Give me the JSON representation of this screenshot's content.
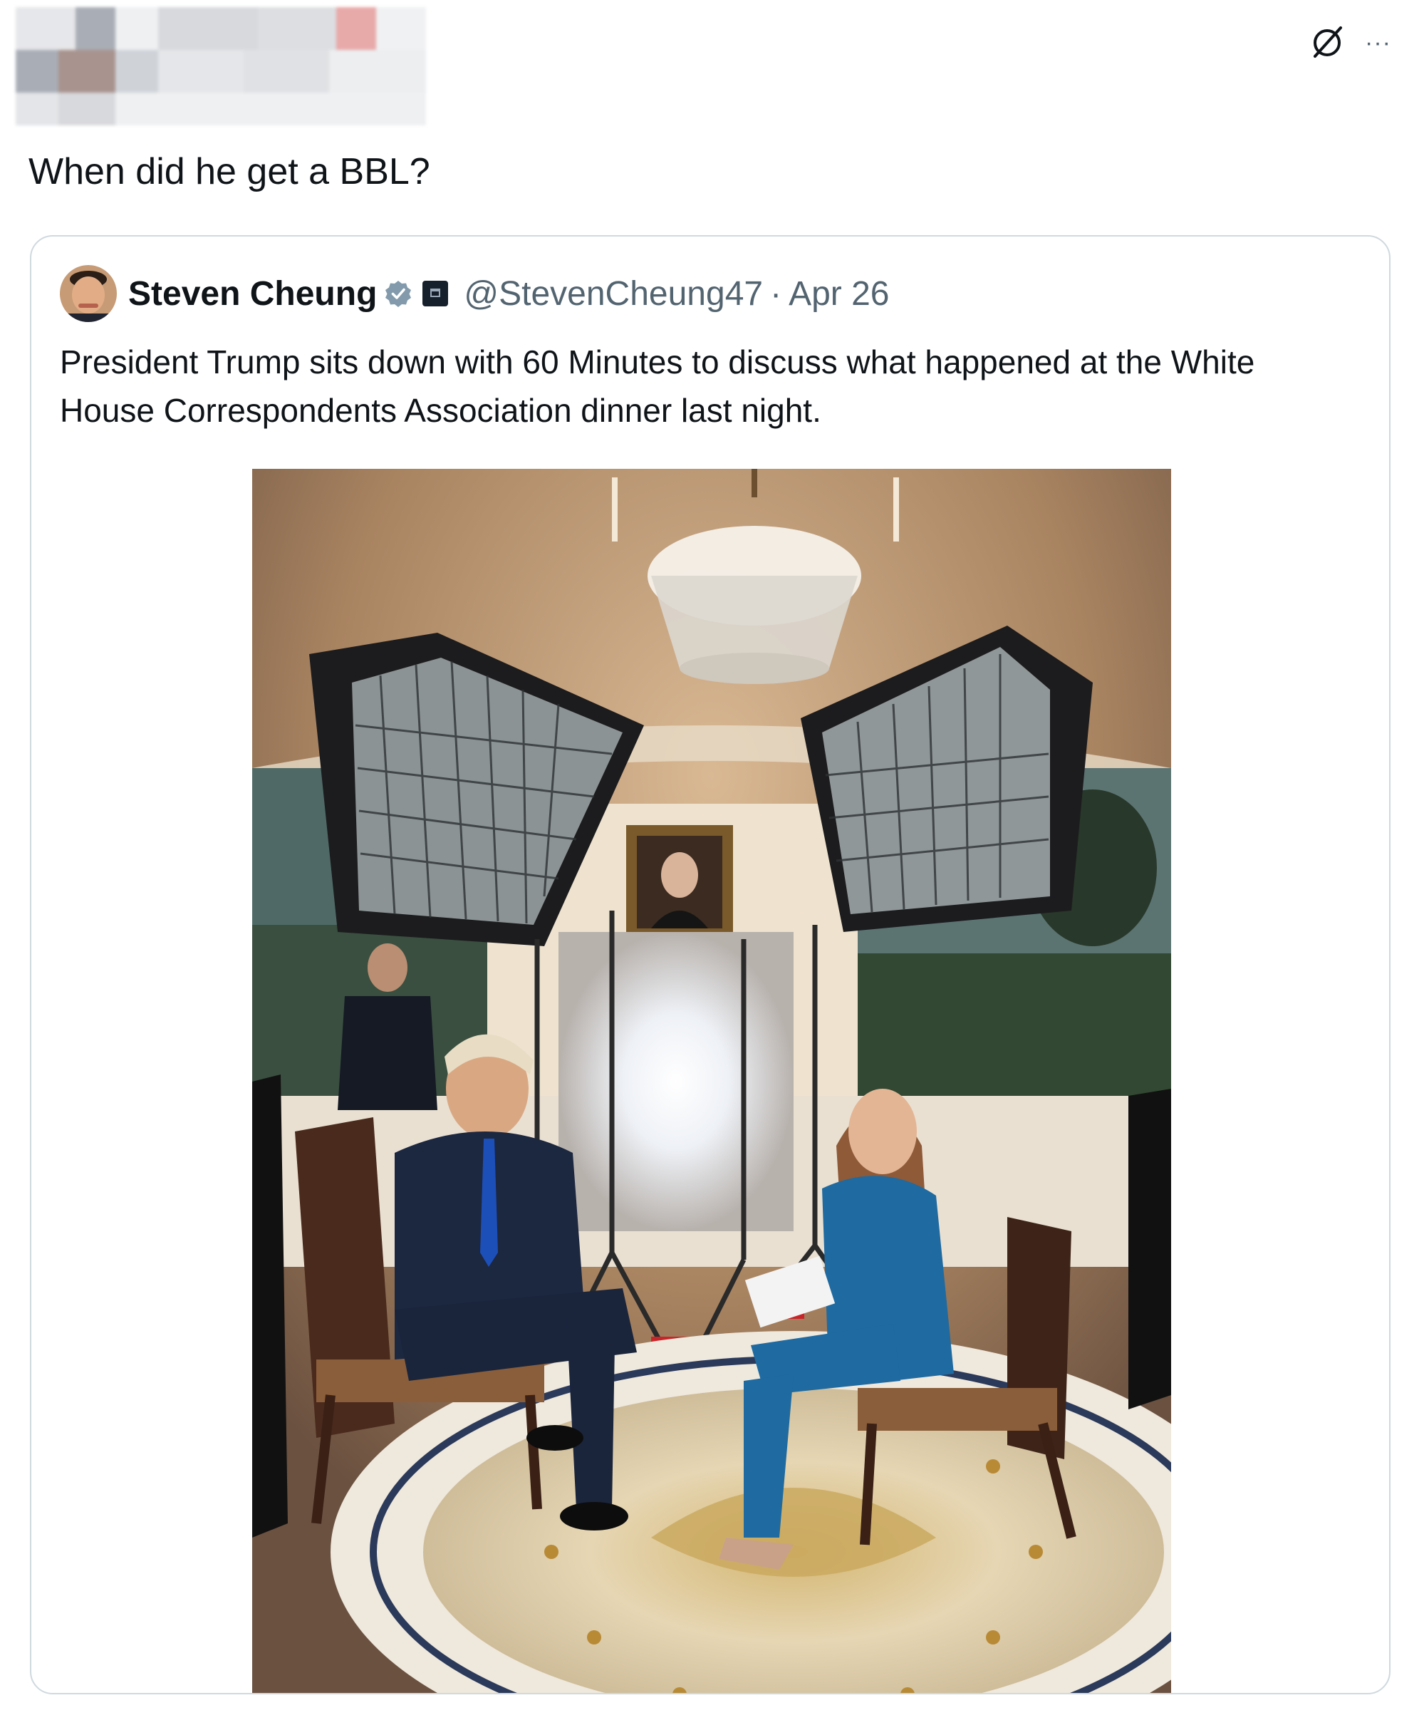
{
  "tweet": {
    "text": "When did he get a BBL?"
  },
  "header": {
    "grok_icon": "grok-icon",
    "more_icon": "more-horizontal-icon",
    "more_label": "···"
  },
  "quoted_tweet": {
    "display_name": "Steven Cheung",
    "verified_icon": "verified-badge-icon",
    "affiliation_icon": "government-affiliation-badge-icon",
    "handle": "@StevenCheung47",
    "separator": "·",
    "date": "Apr 26",
    "text": "President Trump sits down with 60 Minutes to discuss what happened at the White House Correspondents Association dinner last night."
  },
  "colors": {
    "text_primary": "#0f1419",
    "text_secondary": "#536471",
    "border": "#cfd9de",
    "verified": "#829aab"
  }
}
